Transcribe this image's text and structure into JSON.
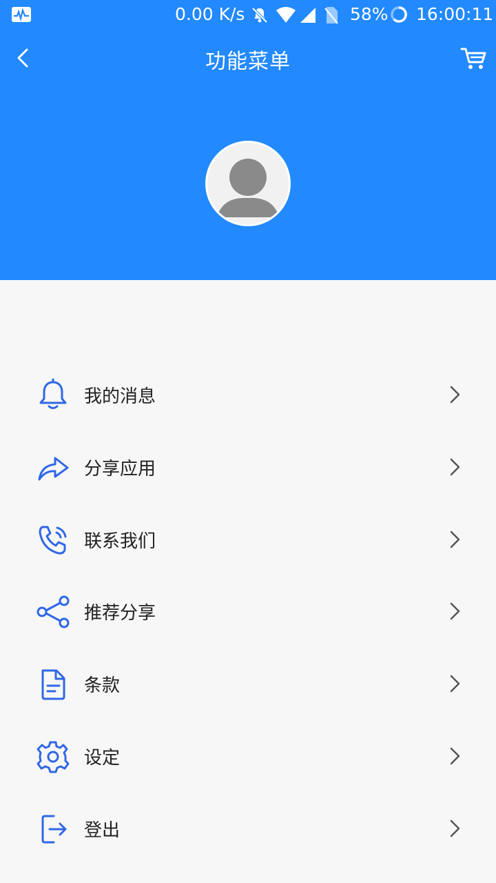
{
  "status_bar": {
    "speed": "0.00 K/s",
    "battery": "58%",
    "time": "16:00:11"
  },
  "header": {
    "title": "功能菜单",
    "background_color": "#2289ff"
  },
  "icons": {
    "back": "chevron-left-icon",
    "cart": "cart-icon",
    "avatar": "person-silhouette-icon"
  },
  "menu": {
    "icon_color": "#2f67e6",
    "items": [
      {
        "label": "我的消息",
        "icon": "bell-icon"
      },
      {
        "label": "分享应用",
        "icon": "share-arrow-icon"
      },
      {
        "label": "联系我们",
        "icon": "phone-icon"
      },
      {
        "label": "推荐分享",
        "icon": "share-nodes-icon"
      },
      {
        "label": "条款",
        "icon": "document-icon"
      },
      {
        "label": "设定",
        "icon": "gear-icon"
      },
      {
        "label": "登出",
        "icon": "logout-icon"
      }
    ]
  }
}
